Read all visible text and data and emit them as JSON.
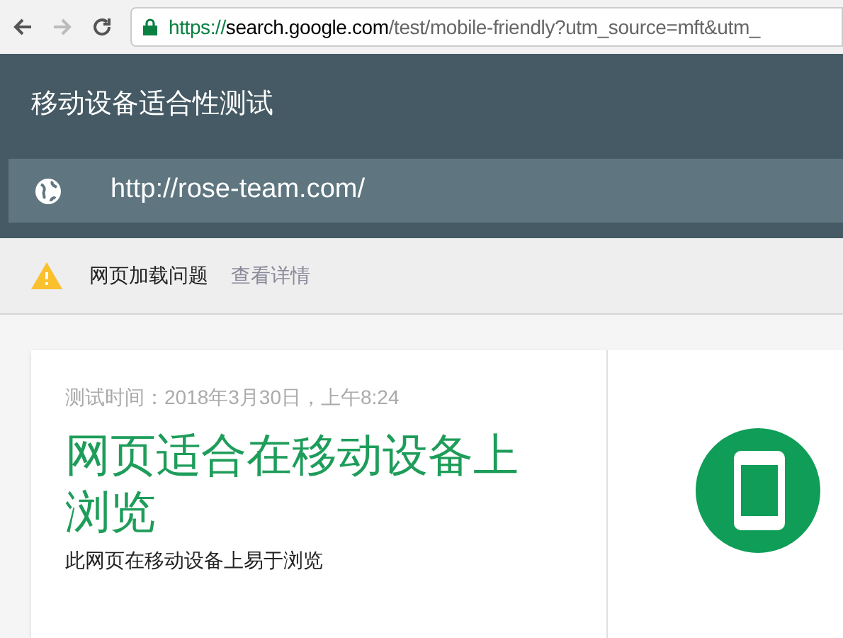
{
  "browser": {
    "url_scheme": "https://",
    "url_host": "search.google.com",
    "url_path": "/test/mobile-friendly?utm_source=mft&utm_"
  },
  "header": {
    "title": "移动设备适合性测试",
    "url_value": "http://rose-team.com/"
  },
  "notice": {
    "message": "网页加载问题",
    "link": "查看详情"
  },
  "result": {
    "test_time": "测试时间：2018年3月30日，上午8:24",
    "headline": "网页适合在移动设备上浏览",
    "description": "此网页在移动设备上易于浏览"
  }
}
